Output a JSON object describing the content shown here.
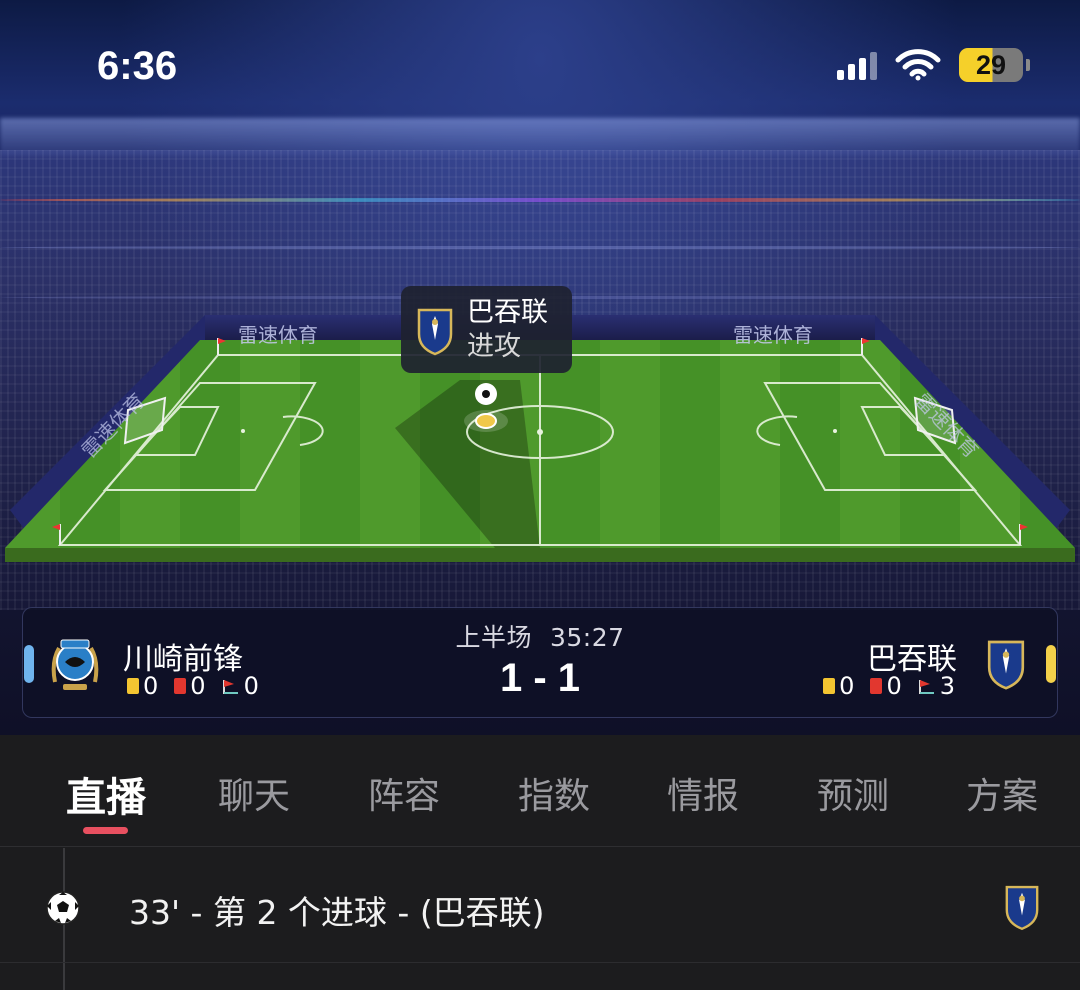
{
  "status_bar": {
    "time": "6:36",
    "battery_level": "29",
    "battery_color": "#f5d02a",
    "icons": [
      "cellular-signal-icon",
      "wifi-icon",
      "battery-icon"
    ]
  },
  "stadium": {
    "board_brand": "雷速体育",
    "attack_tooltip": {
      "team": "巴吞联",
      "action": "进攻"
    }
  },
  "match": {
    "period": "上半场",
    "clock": "35:27",
    "score": "1 - 1",
    "home": {
      "name": "川崎前锋",
      "yellow_cards": "0",
      "red_cards": "0",
      "corners": "0",
      "color": "#6fb4ee"
    },
    "away": {
      "name": "巴吞联",
      "yellow_cards": "0",
      "red_cards": "0",
      "corners": "3",
      "color": "#f3d04a"
    }
  },
  "tabs": [
    {
      "label": "直播",
      "active": true
    },
    {
      "label": "聊天"
    },
    {
      "label": "阵容"
    },
    {
      "label": "指数"
    },
    {
      "label": "情报"
    },
    {
      "label": "预测"
    },
    {
      "label": "方案"
    }
  ],
  "tab_accent": "#e85060",
  "events": [
    {
      "text": "33' - 第 2 个进球 - (巴吞联)",
      "icon": "soccer-ball-icon",
      "team_crest": "bg-pathum-crest-icon"
    }
  ]
}
